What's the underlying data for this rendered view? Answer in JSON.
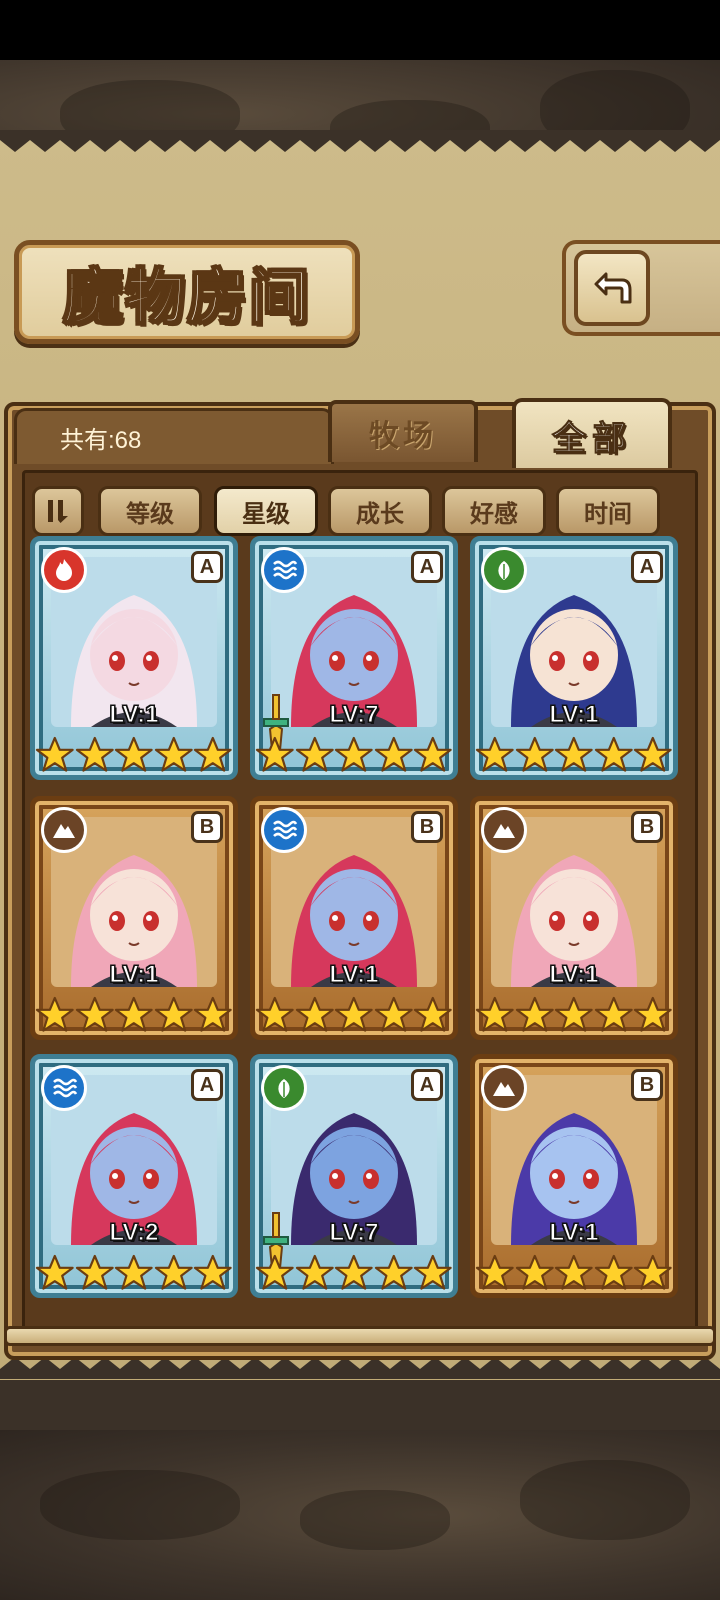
{
  "header": {
    "title": "魔物房间"
  },
  "tabs": {
    "count_label": "共有:68",
    "ranch": "牧场",
    "all": "全部",
    "active": "all"
  },
  "sort": {
    "toggle_icon": "sort-order-icon",
    "buttons": [
      "等级",
      "星级",
      "成长",
      "好感",
      "时间"
    ],
    "active": "星级"
  },
  "colors": {
    "fire": "#d8352b",
    "water": "#1d73c9",
    "earth": "#6b4426",
    "nature": "#3a8a2e",
    "rankA": "#3f7e93",
    "rankB": "#6b3d12"
  },
  "monsters": [
    {
      "element": "fire",
      "rank": "A",
      "level": "LV:1",
      "stars": 5,
      "weapon": false,
      "hair": "#f2e6ef",
      "skin": "#f4d9e2"
    },
    {
      "element": "water",
      "rank": "A",
      "level": "LV:7",
      "stars": 5,
      "weapon": true,
      "hair": "#d6385c",
      "skin": "#9fb7e6"
    },
    {
      "element": "nature",
      "rank": "A",
      "level": "LV:1",
      "stars": 5,
      "weapon": false,
      "hair": "#2e3a8f",
      "skin": "#f6e3d4"
    },
    {
      "element": "earth",
      "rank": "B",
      "level": "LV:1",
      "stars": 5,
      "weapon": false,
      "hair": "#f0a7b8",
      "skin": "#f7e2d8"
    },
    {
      "element": "water",
      "rank": "B",
      "level": "LV:1",
      "stars": 5,
      "weapon": false,
      "hair": "#d6385c",
      "skin": "#9fb7e6"
    },
    {
      "element": "earth",
      "rank": "B",
      "level": "LV:1",
      "stars": 5,
      "weapon": false,
      "hair": "#f0a7b8",
      "skin": "#f7e2d8"
    },
    {
      "element": "water",
      "rank": "A",
      "level": "LV:2",
      "stars": 5,
      "weapon": false,
      "hair": "#d6385c",
      "skin": "#9fb7e6"
    },
    {
      "element": "nature",
      "rank": "A",
      "level": "LV:7",
      "stars": 5,
      "weapon": true,
      "hair": "#3a2a6e",
      "skin": "#7da3e0"
    },
    {
      "element": "earth",
      "rank": "B",
      "level": "LV:1",
      "stars": 5,
      "weapon": false,
      "hair": "#4b3aa8",
      "skin": "#a7c3f0"
    }
  ]
}
